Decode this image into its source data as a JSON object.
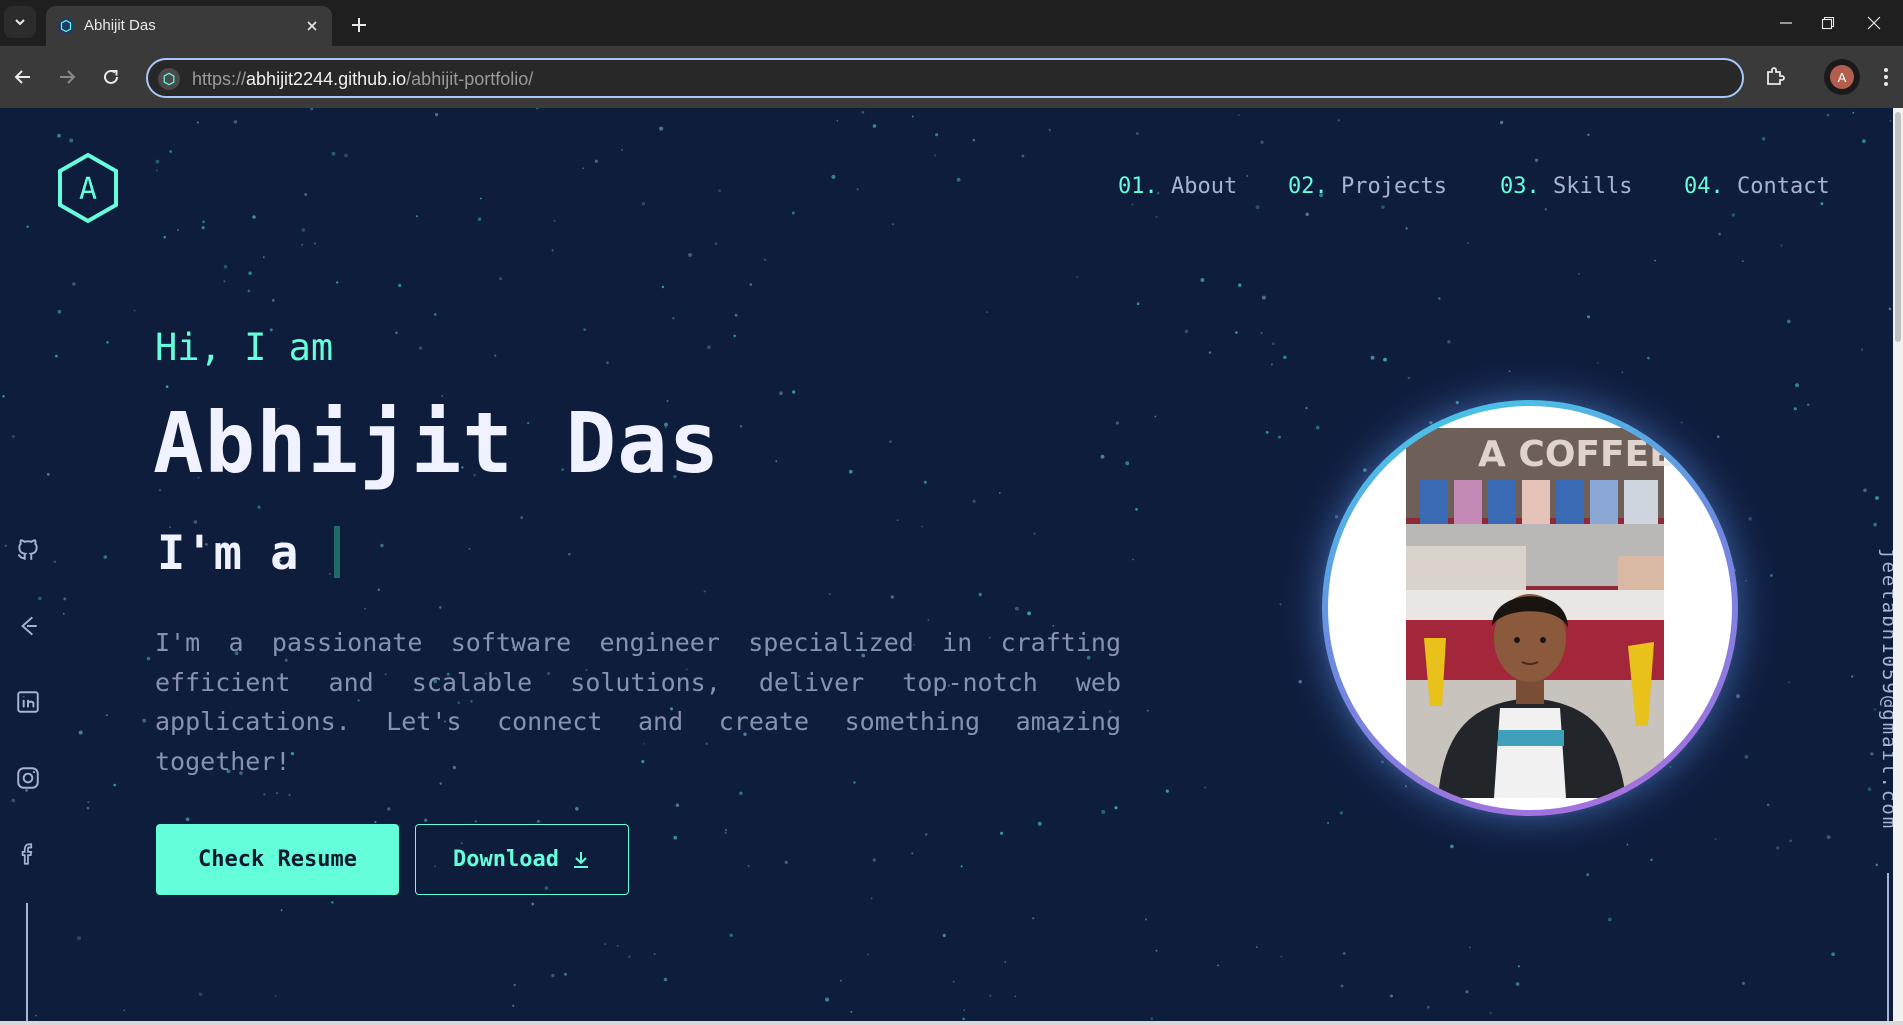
{
  "browser": {
    "tab_title": "Abhijit Das",
    "url_prefix": "https://",
    "url_host": "abhijit2244.github.io",
    "url_path": "/abhijit-portfolio/",
    "profile_initial": "A"
  },
  "nav": {
    "items": [
      {
        "num": "01.",
        "label": "About"
      },
      {
        "num": "02.",
        "label": "Projects"
      },
      {
        "num": "03.",
        "label": "Skills"
      },
      {
        "num": "04.",
        "label": "Contact"
      }
    ]
  },
  "logo": {
    "letter": "A"
  },
  "hero": {
    "greeting": "Hi, I am",
    "name": "Abhijit Das",
    "role_prefix": "I'm a",
    "description": "I'm a passionate software engineer specialized in crafting efficient and scalable solutions, deliver top-notch web applications. Let's connect and create something amazing together!",
    "resume_button": "Check Resume",
    "download_button": "Download"
  },
  "social_icons": [
    "github-icon",
    "codepen-icon",
    "linkedin-icon",
    "instagram-icon",
    "facebook-icon"
  ],
  "email": "jeetabh1059@gmail.com",
  "colors": {
    "accent": "#64ffda",
    "background": "#0f1d3d",
    "text_light": "#f0f3ff",
    "text_muted": "#8892b0"
  }
}
